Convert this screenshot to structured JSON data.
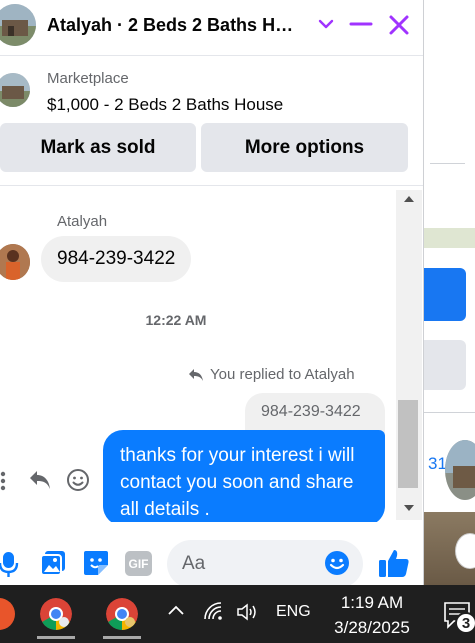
{
  "header": {
    "title": "Atalyah · 2 Beds 2 Baths H…"
  },
  "marketplace": {
    "label": "Marketplace",
    "listing_title": "$1,000 - 2 Beds 2 Baths House",
    "mark_sold_label": "Mark as sold",
    "more_options_label": "More options"
  },
  "conversation": {
    "sender_name": "Atalyah",
    "incoming_message": "984-239-3422",
    "timestamp": "12:22 AM",
    "replied_note": "You replied to Atalyah",
    "quoted_message": "984-239-3422",
    "outgoing_message": "thanks for your interest i will contact you soon and share all details ."
  },
  "composer": {
    "placeholder": "Aa",
    "gif_label": "GIF"
  },
  "background_page": {
    "partial_number": "31"
  },
  "taskbar": {
    "language": "ENG",
    "time": "1:19 AM",
    "date": "3/28/2025",
    "notification_count": "3"
  },
  "colors": {
    "accent": "#0a7cff",
    "messenger_purple": "#a033ff",
    "taskbar_bg": "#1f1f1f"
  }
}
